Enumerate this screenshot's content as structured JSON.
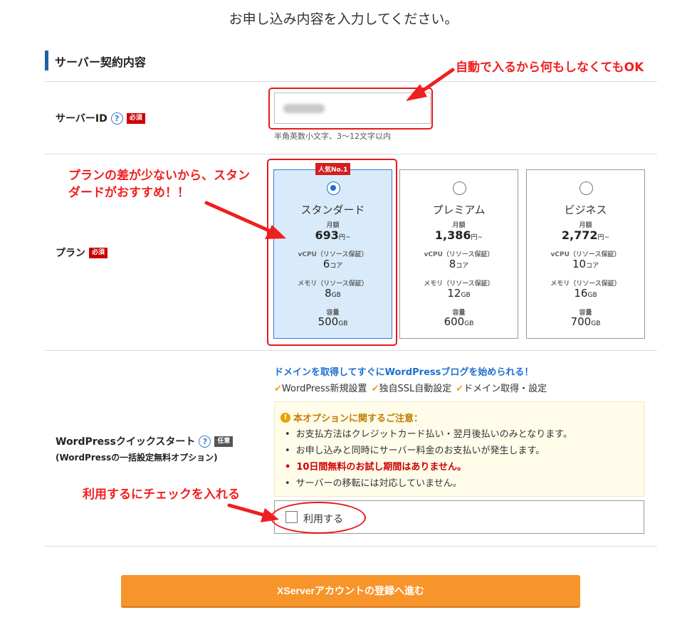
{
  "page_title": "お申し込み内容を入力してください。",
  "section_title": "サーバー契約内容",
  "server_id": {
    "label": "サーバーID",
    "required_badge": "必須",
    "hint": "半角英数小文字、3〜12文字以内"
  },
  "plan": {
    "label": "プラン",
    "required_badge": "必須",
    "popular_badge": "人気No.1",
    "cards": [
      {
        "name": "スタンダード",
        "price_label": "月額",
        "price": "693",
        "price_unit": "円~",
        "vcpu_label": "vCPU（リソース保証）",
        "vcpu": "6",
        "vcpu_unit": "コア",
        "memory_label": "メモリ（リソース保証）",
        "memory": "8",
        "memory_unit": "GB",
        "storage_label": "容量",
        "storage": "500",
        "storage_unit": "GB",
        "selected": true
      },
      {
        "name": "プレミアム",
        "price_label": "月額",
        "price": "1,386",
        "price_unit": "円~",
        "vcpu_label": "vCPU（リソース保証）",
        "vcpu": "8",
        "vcpu_unit": "コア",
        "memory_label": "メモリ（リソース保証）",
        "memory": "12",
        "memory_unit": "GB",
        "storage_label": "容量",
        "storage": "600",
        "storage_unit": "GB",
        "selected": false
      },
      {
        "name": "ビジネス",
        "price_label": "月額",
        "price": "2,772",
        "price_unit": "円~",
        "vcpu_label": "vCPU（リソース保証）",
        "vcpu": "10",
        "vcpu_unit": "コア",
        "memory_label": "メモリ（リソース保証）",
        "memory": "16",
        "memory_unit": "GB",
        "storage_label": "容量",
        "storage": "700",
        "storage_unit": "GB",
        "selected": false
      }
    ]
  },
  "wordpress": {
    "label": "WordPressクイックスタート",
    "optional_badge": "任意",
    "sub_label": "(WordPressの一括設定無料オプション)",
    "lead": "ドメインを取得してすぐにWordPressブログを始められる！",
    "features": [
      "WordPress新規設置",
      "独自SSL自動設定",
      "ドメイン取得・設定"
    ],
    "notice_title": "本オプションに関するご注意：",
    "notice_items": [
      "お支払方法はクレジットカード払い・翌月後払いのみとなります。",
      "お申し込みと同時にサーバー料金のお支払いが発生します。",
      "10日間無料のお試し期間はありません。",
      "サーバーの移転には対応していません。"
    ],
    "use_label": "利用する"
  },
  "submit_label": "XServerアカウントの登録へ進む",
  "annotations": {
    "auto_fill": "自動で入るから何もしなくてもOK",
    "plan_line1": "プランの差が少ないから、スタン",
    "plan_line2": "ダードがおすすめ！！",
    "check_hint": "利用するにチェックを入れる"
  },
  "colors": {
    "accent_blue": "#1f5fa8",
    "required_red": "#cc0000",
    "button_orange": "#f7952a",
    "annotation_red": "#f01f1f",
    "selected_card": "#d9ebfb"
  }
}
